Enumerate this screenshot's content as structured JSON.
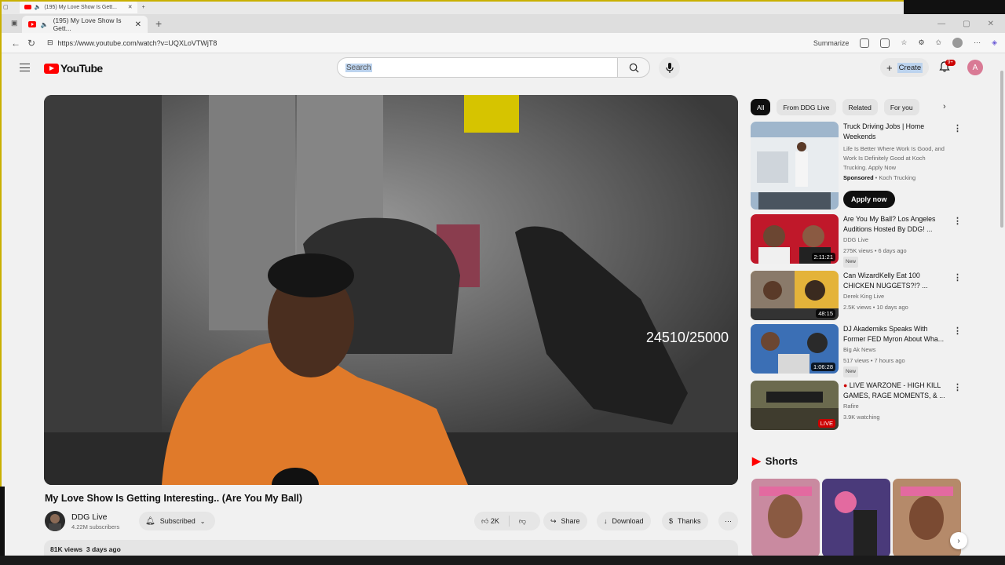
{
  "outer_tab": {
    "title": "(195) My Love Show Is Gett..."
  },
  "browser": {
    "tab_title": "(195) My Love Show Is Gett...",
    "url": "https://www.youtube.com/watch?v=UQXLoVTWjT8",
    "summarize_label": "Summarize"
  },
  "header": {
    "logo_text": "YouTube",
    "search_placeholder": "Search",
    "create_label": "Create",
    "notif_count": "9+",
    "avatar_letter": "A"
  },
  "player": {
    "overlay_counter": "24510/25000"
  },
  "video": {
    "title": "My Love Show Is Getting Interesting.. (Are You My Ball)",
    "channel": "DDG Live",
    "subscribers": "4.22M subscribers",
    "subscribed_label": "Subscribed",
    "likes": "2K",
    "share_label": "Share",
    "download_label": "Download",
    "thanks_label": "Thanks",
    "views": "81K views",
    "age": "3 days ago"
  },
  "chips": [
    "All",
    "From DDG Live",
    "Related",
    "For you"
  ],
  "ad": {
    "title": "Truck Driving Jobs | Home Weekends",
    "desc": "Life Is Better Where Work Is Good, and Work Is Definitely Good at Koch Trucking. Apply Now",
    "sponsored": "Sponsored",
    "advertiser": "Koch Trucking",
    "cta": "Apply now"
  },
  "recommendations": [
    {
      "title": "Are You My Ball? Los Angeles Auditions Hosted By DDG! ...",
      "channel": "DDG Live",
      "stats": "275K views • 6 days ago",
      "badge": "New",
      "duration": "2:11:21"
    },
    {
      "title": "Can WizardKelly Eat 100 CHICKEN NUGGETS?!? ...",
      "channel": "Derek King Live",
      "stats": "2.5K views • 10 days ago",
      "badge": "",
      "duration": "48:15"
    },
    {
      "title": "DJ Akademiks Speaks With Former FED Myron About Wha...",
      "channel": "Big Ak News",
      "stats": "517 views • 7 hours ago",
      "badge": "New",
      "duration": "1:06:28"
    },
    {
      "title": "LIVE WARZONE - HIGH KILL GAMES, RAGE MOMENTS, & ...",
      "channel": "Rafire",
      "stats": "3.9K watching",
      "badge": "",
      "duration": "LIVE"
    }
  ],
  "shorts": {
    "heading": "Shorts"
  },
  "colors": {
    "yt_red": "#ff0000",
    "accent_border": "#c9b000"
  }
}
